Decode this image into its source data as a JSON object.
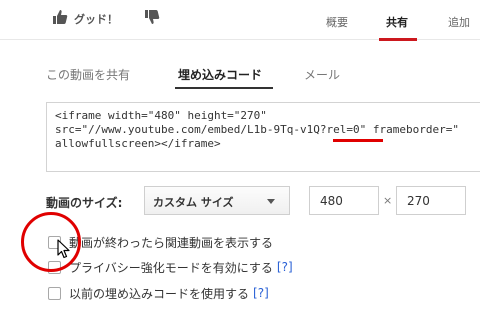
{
  "header": {
    "like_label": "グッド！",
    "tabs": [
      {
        "label": "概要"
      },
      {
        "label": "共有"
      },
      {
        "label": "追加"
      }
    ],
    "active_tab": "共有"
  },
  "share": {
    "subtabs": [
      {
        "label": "この動画を共有"
      },
      {
        "label": "埋め込みコード"
      },
      {
        "label": "メール"
      }
    ],
    "active_subtab": "埋め込みコード",
    "embed_lines": [
      "<iframe width=\"480\" height=\"270\"",
      "src=\"//www.youtube.com/embed/L1b-9Tq-v1Q?rel=0\" frameborder=\"",
      "allowfullscreen></iframe>"
    ],
    "size_label": "動画のサイズ:",
    "size_option": "カスタム サイズ",
    "width_value": "480",
    "times_symbol": "×",
    "height_value": "270",
    "options": [
      {
        "label": "動画が終わったら関連動画を表示する",
        "checked": false,
        "help": ""
      },
      {
        "label": "プライバシー強化モードを有効にする",
        "checked": false,
        "help": "[?]"
      },
      {
        "label": "以前の埋め込みコードを使用する",
        "checked": false,
        "help": "[?]"
      }
    ]
  },
  "colors": {
    "accent_red": "#cc181e",
    "annotation_red": "#e00000",
    "link_blue": "#2b62d6"
  }
}
